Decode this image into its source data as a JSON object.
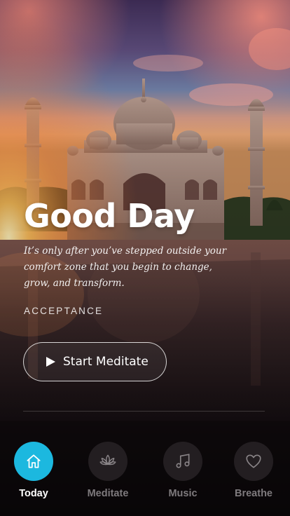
{
  "hero": {
    "title": "Good Day",
    "quote": "It’s only after you’ve stepped outside your comfort zone that you begin to change, grow, and transform.",
    "tag": "ACCEPTANCE",
    "cta_label": "Start Meditate"
  },
  "nav": {
    "items": [
      {
        "label": "Today",
        "icon": "home-icon",
        "active": true
      },
      {
        "label": "Meditate",
        "icon": "lotus-icon",
        "active": false
      },
      {
        "label": "Music",
        "icon": "music-note-icon",
        "active": false
      },
      {
        "label": "Breathe",
        "icon": "heart-icon",
        "active": false
      }
    ],
    "active_color": "#1cb8df"
  }
}
